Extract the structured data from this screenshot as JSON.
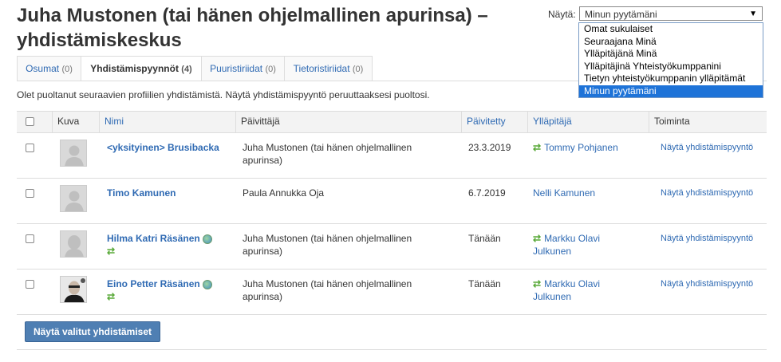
{
  "page": {
    "title": "Juha Mustonen (tai hänen ohjelmallinen apurinsa) – yhdistämiskeskus"
  },
  "filter": {
    "label": "Näytä:",
    "selected": "Minun pyytämäni",
    "options": [
      "Omat sukulaiset",
      "Seuraajana Minä",
      "Ylläpitäjänä Minä",
      "Ylläpitäjinä Yhteistyökumppanini",
      "Tietyn yhteistyökumppanin ylläpitämät",
      "Minun pyytämäni"
    ]
  },
  "tabs": [
    {
      "label": "Osumat",
      "count": "(0)"
    },
    {
      "label": "Yhdistämispyynnöt",
      "count": "(4)"
    },
    {
      "label": "Puuristiriidat",
      "count": "(0)"
    },
    {
      "label": "Tietoristiriidat",
      "count": "(0)"
    }
  ],
  "info_text": "Olet puoltanut seuraavien profiilien yhdistämistä. Näytä yhdistämispyyntö peruuttaaksesi puoltosi.",
  "table": {
    "headers": {
      "kuva": "Kuva",
      "nimi": "Nimi",
      "paivittaja": "Päivittäjä",
      "paivitetty": "Päivitetty",
      "yllapitaja": "Ylläpitäjä",
      "toiminta": "Toiminta"
    },
    "rows": [
      {
        "name": "<yksityinen> Brusibacka",
        "updater_1": "Juha Mustonen (tai hänen ohjelmallinen",
        "updater_2": "apurinsa)",
        "date": "23.3.2019",
        "manager_1": "Tommy Pohjanen",
        "manager_2": "",
        "action": "Näytä yhdistämispyyntö"
      },
      {
        "name": "Timo Kamunen",
        "updater_1": "Paula Annukka Oja",
        "updater_2": "",
        "date": "6.7.2019",
        "manager_1": "Nelli Kamunen",
        "manager_2": "",
        "action": "Näytä yhdistämispyyntö"
      },
      {
        "name": "Hilma Katri Räsänen",
        "updater_1": "Juha Mustonen (tai hänen ohjelmallinen",
        "updater_2": "apurinsa)",
        "date": "Tänään",
        "manager_1": "Markku Olavi",
        "manager_2": "Julkunen",
        "action": "Näytä yhdistämispyyntö"
      },
      {
        "name": "Eino Petter Räsänen",
        "updater_1": "Juha Mustonen (tai hänen ohjelmallinen",
        "updater_2": "apurinsa)",
        "date": "Tänään",
        "manager_1": "Markku Olavi",
        "manager_2": "Julkunen",
        "action": "Näytä yhdistämispyyntö"
      }
    ]
  },
  "button": {
    "label": "Näytä valitut yhdistämiset"
  },
  "colors": {
    "link": "#2f6ab3",
    "button": "#4f7fb3",
    "selected_option": "#1e73d8",
    "swap_icon": "#5aaa3a"
  }
}
